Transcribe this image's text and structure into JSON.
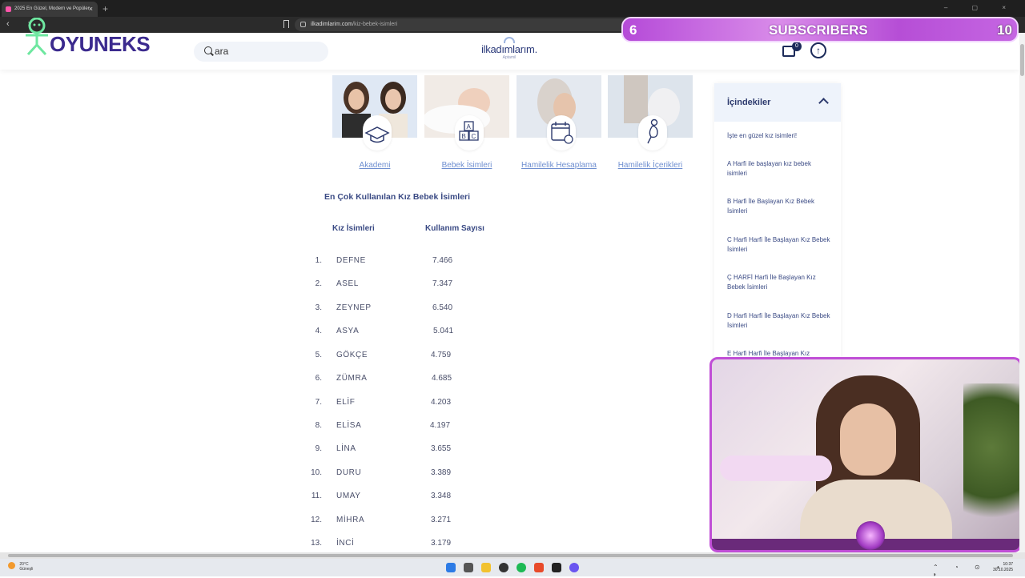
{
  "browser": {
    "tab_title": "2025 En Güzel, Modern ve Popüler",
    "tab_close": "×",
    "new_tab": "+",
    "url_domain": "ilkadimlarim.com",
    "url_path": "/kiz-bebek-isimleri",
    "nav_arrows": "‹ ›",
    "window_controls": "– ▢ ×"
  },
  "header": {
    "search_value": "ara",
    "logo_text": "ilkadımlarım.",
    "logo_sub": "Aptamil",
    "cart_count": "0",
    "scroll_up": "↑"
  },
  "overlay": {
    "brand": "OYUNEKS",
    "sub_left": "6",
    "sub_label": "SUBSCRIBERS",
    "sub_right": "10"
  },
  "cards": [
    {
      "label": "Akademi",
      "icon": "graduation-cap-icon"
    },
    {
      "label": "Bebek İsimleri",
      "icon": "abc-blocks-icon"
    },
    {
      "label": "Hamilelik Hesaplama",
      "icon": "calendar-icon"
    },
    {
      "label": "Hamilelik İçerikleri",
      "icon": "pregnancy-icon"
    }
  ],
  "article": {
    "heading": "En Çok Kullanılan Kız Bebek İsimleri",
    "col_names": "Kız İsimleri",
    "col_count": "Kullanım Sayısı",
    "rows": [
      {
        "rank": "1.",
        "name": "DEFNE",
        "count": "7.466"
      },
      {
        "rank": "2.",
        "name": "ASEL",
        "count": "7.347"
      },
      {
        "rank": "3.",
        "name": "ZEYNEP",
        "count": "6.540"
      },
      {
        "rank": "4.",
        "name": "ASYA",
        "count": "5.041"
      },
      {
        "rank": "5.",
        "name": "GÖKÇE",
        "count": "4.759"
      },
      {
        "rank": "6.",
        "name": "ZÜMRA",
        "count": "4.685"
      },
      {
        "rank": "7.",
        "name": "ELİF",
        "count": "4.203"
      },
      {
        "rank": "8.",
        "name": "ELİSA",
        "count": "4.197"
      },
      {
        "rank": "9.",
        "name": "LİNA",
        "count": "3.655"
      },
      {
        "rank": "10.",
        "name": "DURU",
        "count": "3.389"
      },
      {
        "rank": "11.",
        "name": "UMAY",
        "count": "3.348"
      },
      {
        "rank": "12.",
        "name": "MİHRA",
        "count": "3.271"
      },
      {
        "rank": "13.",
        "name": "İNCİ",
        "count": "3.179"
      }
    ]
  },
  "toc": {
    "title": "İçindekiler",
    "items": [
      "İşte en güzel kız isimleri!",
      "A Harfi ile başlayan kız bebek isimleri",
      "B Harfi İle Başlayan Kız Bebek İsimleri",
      "C Harfi Harfi İle Başlayan Kız Bebek İsimleri",
      "Ç HARFİ Harfi İle Başlayan Kız Bebek İsimleri",
      "D Harfi Harfi İle Başlayan Kız Bebek İsimleri",
      "E Harfi Harfi İle Başlayan Kız"
    ]
  },
  "taskbar": {
    "weather_temp": "20°C",
    "weather_desc": "Güneşli",
    "time": "10:37",
    "date": "30.10.2025"
  },
  "colors": {
    "accent": "#3a4a84",
    "link": "#6f8fd0",
    "overlay_purple": "#b54ad8"
  }
}
